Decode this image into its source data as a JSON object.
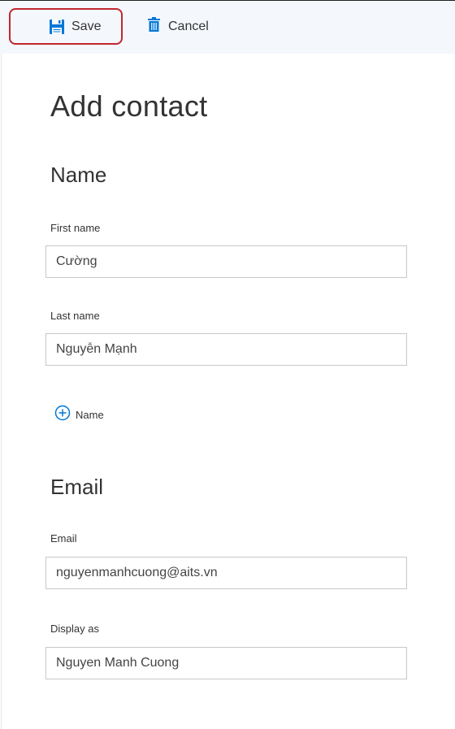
{
  "colors": {
    "accent": "#0078d7",
    "highlight": "#c0282e",
    "toolbar_bg": "#f4f7fc"
  },
  "toolbar": {
    "save": {
      "label": "Save",
      "icon": "save-icon"
    },
    "cancel": {
      "label": "Cancel",
      "icon": "trash-icon"
    }
  },
  "page_title": "Add contact",
  "name_section": {
    "title": "Name",
    "first_name": {
      "label": "First name",
      "value": "Cường"
    },
    "last_name": {
      "label": "Last name",
      "value": "Nguyễn Mạnh"
    },
    "add_name": {
      "label": "Name",
      "icon": "add-circle-icon"
    }
  },
  "email_section": {
    "title": "Email",
    "email": {
      "label": "Email",
      "value": "nguyenmanhcuong@aits.vn"
    },
    "display_as": {
      "label": "Display as",
      "value": "Nguyen Manh Cuong"
    }
  }
}
